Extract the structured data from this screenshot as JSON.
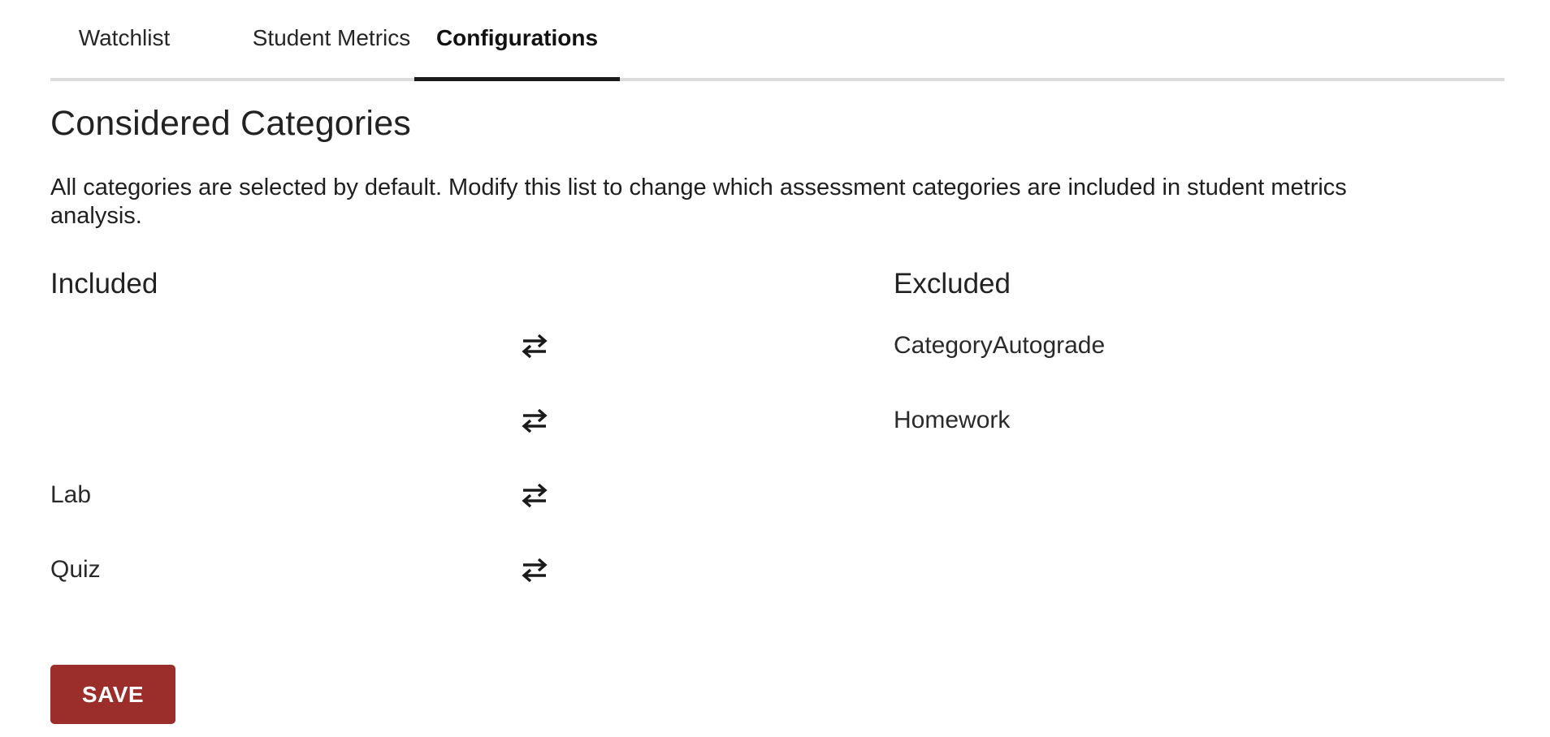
{
  "tabs": {
    "watchlist": "Watchlist",
    "student_metrics": "Student Metrics",
    "configurations": "Configurations",
    "active": "configurations"
  },
  "section": {
    "title": "Considered Categories",
    "description": "All categories are selected by default. Modify this list to change which assessment categories are included in student metrics analysis."
  },
  "columns": {
    "included_title": "Included",
    "excluded_title": "Excluded"
  },
  "rows": [
    {
      "included": "",
      "excluded": "CategoryAutograde",
      "icon": "swap-arrows-icon"
    },
    {
      "included": "",
      "excluded": "Homework",
      "icon": "swap-arrows-icon"
    },
    {
      "included": "Lab",
      "excluded": "",
      "icon": "swap-arrows-icon"
    },
    {
      "included": "Quiz",
      "excluded": "",
      "icon": "swap-arrows-icon"
    }
  ],
  "actions": {
    "save_label": "SAVE"
  },
  "colors": {
    "save_button_bg": "#9b2d2b",
    "active_tab_underline": "#1a1a1a",
    "tab_border": "#dcdcdc"
  }
}
